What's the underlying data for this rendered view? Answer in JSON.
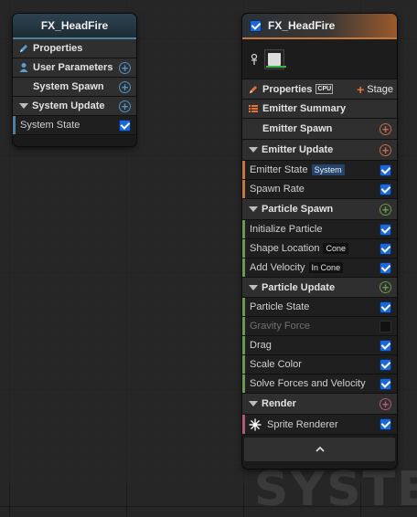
{
  "system_node": {
    "title": "FX_HeadFire",
    "properties": "Properties",
    "user_parameters": "User Parameters",
    "system_spawn": "System Spawn",
    "system_update": "System Update",
    "system_state": "System State"
  },
  "emitter_node": {
    "title": "FX_HeadFire",
    "properties": "Properties",
    "cpu_badge": "CPU",
    "stage_button": "Stage",
    "emitter_summary": "Emitter Summary",
    "emitter_spawn": "Emitter Spawn",
    "emitter_update": "Emitter Update",
    "emitter_state": "Emitter State",
    "emitter_state_tag": "System",
    "spawn_rate": "Spawn Rate",
    "particle_spawn": "Particle Spawn",
    "initialize_particle": "Initialize Particle",
    "shape_location": "Shape Location",
    "shape_location_tag": "Cone",
    "add_velocity": "Add Velocity",
    "add_velocity_tag": "In Cone",
    "particle_update": "Particle Update",
    "particle_state": "Particle State",
    "gravity_force": "Gravity Force",
    "drag": "Drag",
    "scale_color": "Scale Color",
    "solve_forces": "Solve Forces and Velocity",
    "render": "Render",
    "sprite_renderer": "Sprite Renderer"
  },
  "watermark": "SYSTE",
  "colors": {
    "system_accent": "#4e7ea0",
    "emitter_accent": "#c4773b",
    "spawn_green": "#6a9a4a",
    "render_pink": "#b05a7a",
    "check_blue": "#1b68d8"
  }
}
